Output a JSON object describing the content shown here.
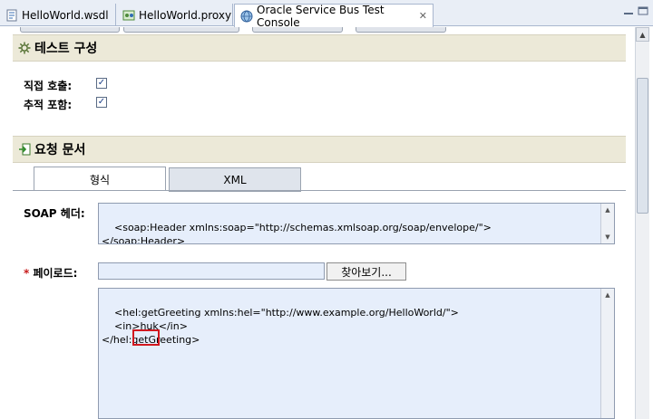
{
  "tabs": [
    {
      "label": "HelloWorld.wsdl",
      "icon": "wsdl-file-icon"
    },
    {
      "label": "HelloWorld.proxy",
      "icon": "proxy-file-icon"
    },
    {
      "label": "Oracle Service Bus Test Console",
      "icon": "globe-icon",
      "active": true
    }
  ],
  "test_config": {
    "title": "테스트 구성",
    "direct_call_label": "직접 호출:",
    "include_trace_label": "추적 포함:",
    "direct_call_checked": true,
    "include_trace_checked": true
  },
  "request_doc": {
    "title": "요청 문서",
    "tab_form": "형식",
    "tab_xml": "XML",
    "soap_header_label": "SOAP 헤더:",
    "soap_header_value": "<soap:Header xmlns:soap=\"http://schemas.xmlsoap.org/soap/envelope/\">\n</soap:Header>",
    "payload_required_mark": "*",
    "payload_label": " 페이로드:",
    "browse_label": "찾아보기...",
    "payload_value": "<hel:getGreeting xmlns:hel=\"http://www.example.org/HelloWorld/\">\n    <in>huk</in>\n</hel:getGreeting>"
  },
  "colors": {
    "section_bg": "#ece9d8",
    "field_bg": "#e6eefb",
    "highlight": "#d1181f"
  }
}
